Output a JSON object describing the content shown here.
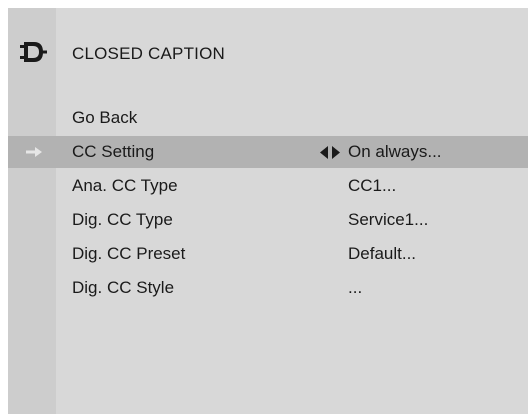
{
  "header": {
    "title": "CLOSED CAPTION",
    "icon": "plug-connector-icon"
  },
  "menu": {
    "go_back": "Go Back",
    "items": [
      {
        "label": "CC Setting",
        "value": "On always...",
        "selected": true
      },
      {
        "label": "Ana. CC Type",
        "value": "CC1..."
      },
      {
        "label": "Dig. CC Type",
        "value": "Service1..."
      },
      {
        "label": "Dig. CC Preset",
        "value": "Default..."
      },
      {
        "label": "Dig. CC Style",
        "value": "..."
      }
    ],
    "selection_pointer_icon": "arrow-right-icon",
    "value_arrows_icon": "left-right-arrows-icon"
  },
  "colors": {
    "panel": "#d8d8d8",
    "icon_column": "#cdcdcd",
    "highlight": "#b2b2b2",
    "text": "#1a1a1a",
    "pointer": "#e6e6e6"
  }
}
